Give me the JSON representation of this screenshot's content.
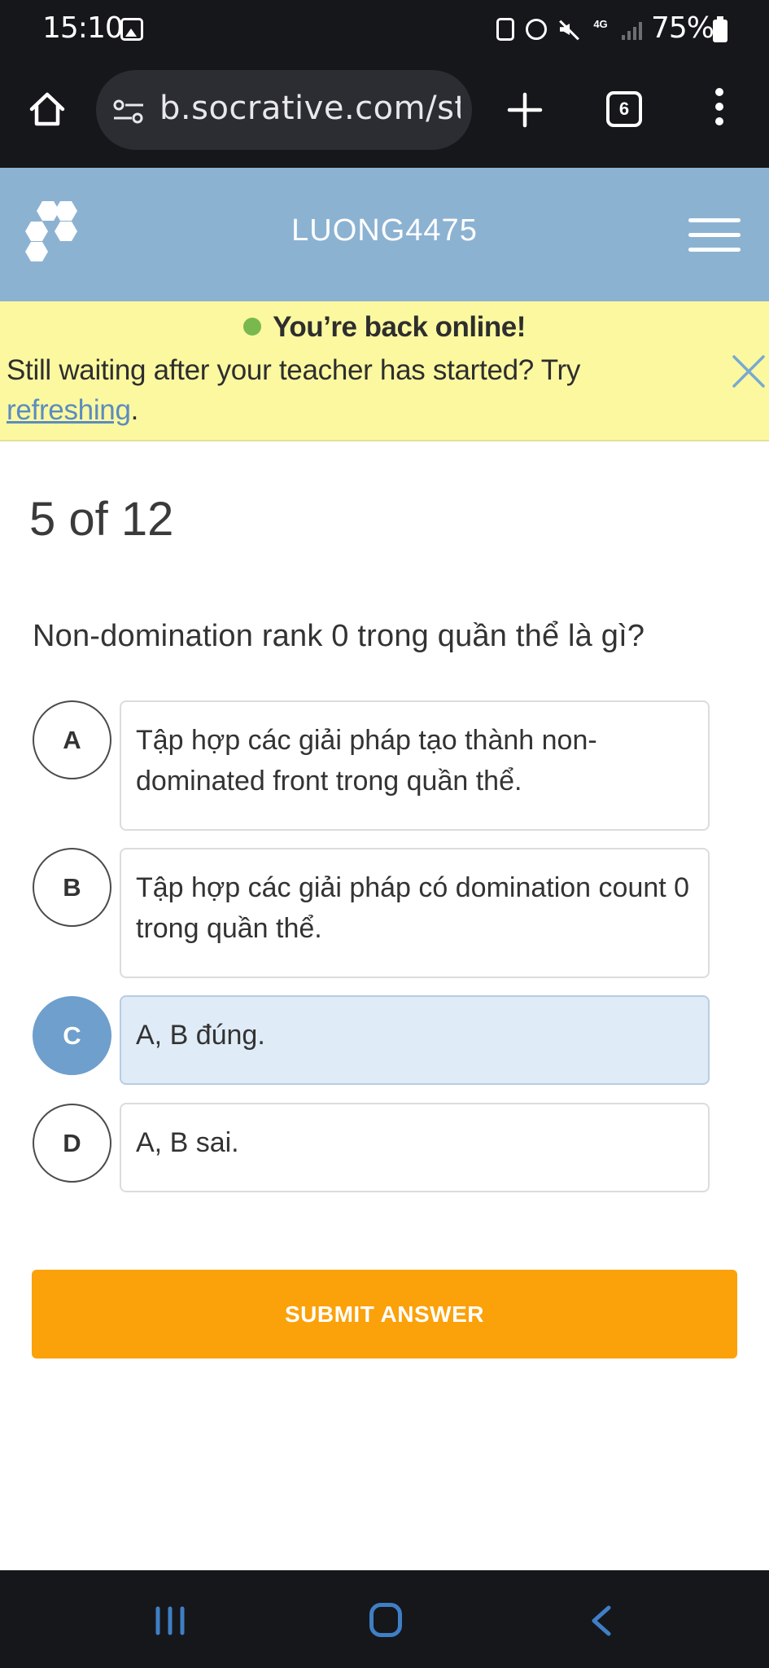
{
  "status_bar": {
    "time": "15:10",
    "network": "4G",
    "battery": "75%"
  },
  "browser": {
    "url": "b.socrative.com/st",
    "tab_count": "6"
  },
  "header": {
    "room_name": "LUONG4475"
  },
  "banner": {
    "title": "You’re back online!",
    "message": "Still waiting after your teacher has started? Try ",
    "link": "refreshing",
    "suffix": "."
  },
  "quiz": {
    "progress": "5 of 12",
    "question": "Non-domination rank 0 trong quần thể là gì?",
    "choices": [
      {
        "letter": "A",
        "text": "Tập hợp các giải pháp tạo thành non-dominated front trong quần thể.",
        "selected": false
      },
      {
        "letter": "B",
        "text": "Tập hợp các giải pháp có domination count 0 trong quần thể.",
        "selected": false
      },
      {
        "letter": "C",
        "text": "A, B đúng.",
        "selected": true
      },
      {
        "letter": "D",
        "text": "A, B sai.",
        "selected": false
      }
    ],
    "submit_label": "SUBMIT ANSWER"
  },
  "colors": {
    "header_bg": "#8cb2d2",
    "banner_bg": "#fbf8a0",
    "selected_bg": "#dfebf6",
    "selected_circle": "#6f9fcc",
    "submit_bg": "#fba10a"
  }
}
